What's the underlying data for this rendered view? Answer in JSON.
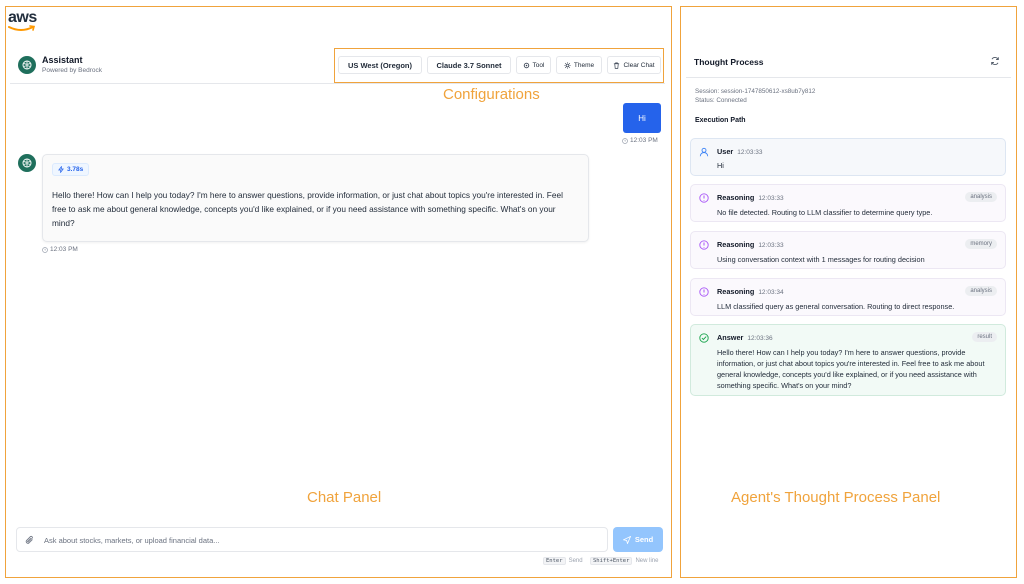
{
  "brand": {
    "logo_text": "aws"
  },
  "callouts": {
    "configurations": "Configurations",
    "chat_panel": "Chat Panel",
    "thought_panel": "Agent's Thought Process Panel"
  },
  "chat": {
    "header": {
      "title": "Assistant",
      "subtitle": "Powered by Bedrock"
    },
    "config": {
      "region": "US West (Oregon)",
      "model": "Claude 3.7 Sonnet",
      "tool": "Tool",
      "theme": "Theme",
      "clear": "Clear Chat"
    },
    "messages": [
      {
        "role": "user",
        "text": "Hi",
        "time": "12:03 PM"
      },
      {
        "role": "assistant",
        "duration": "3.78s",
        "text": "Hello there! How can I help you today? I'm here to answer questions, provide information, or just chat about topics you're interested in. Feel free to ask me about general knowledge, concepts you'd like explained, or if you need assistance with something specific. What's on your mind?",
        "time": "12:03 PM"
      }
    ],
    "input": {
      "placeholder": "Ask about stocks, markets, or upload financial data..."
    },
    "send_label": "Send",
    "hints": {
      "send_key": "Enter",
      "send_text": "Send",
      "newline_key": "Shift+Enter",
      "newline_text": "New line"
    }
  },
  "thought": {
    "title": "Thought Process",
    "session": "Session: session-1747850612-xs8ub7y812",
    "status": "Status: Connected",
    "path_label": "Execution Path",
    "steps": [
      {
        "type": "User",
        "time": "12:03:33",
        "tag": "",
        "text": "Hi"
      },
      {
        "type": "Reasoning",
        "time": "12:03:33",
        "tag": "analysis",
        "text": "No file detected. Routing to LLM classifier to determine query type."
      },
      {
        "type": "Reasoning",
        "time": "12:03:33",
        "tag": "memory",
        "text": "Using conversation context with 1 messages for routing decision"
      },
      {
        "type": "Reasoning",
        "time": "12:03:34",
        "tag": "analysis",
        "text": "LLM classified query as general conversation. Routing to direct response."
      },
      {
        "type": "Answer",
        "time": "12:03:36",
        "tag": "result",
        "text": "Hello there! How can I help you today? I'm here to answer questions, provide information, or just chat about topics you're interested in. Feel free to ask me about general knowledge, concepts you'd like explained, or if you need assistance with something specific. What's on your mind?"
      }
    ]
  },
  "colors": {
    "accent": "#2563eb",
    "annotation": "#f0a33c",
    "bot_avatar": "#1f6f5c"
  }
}
